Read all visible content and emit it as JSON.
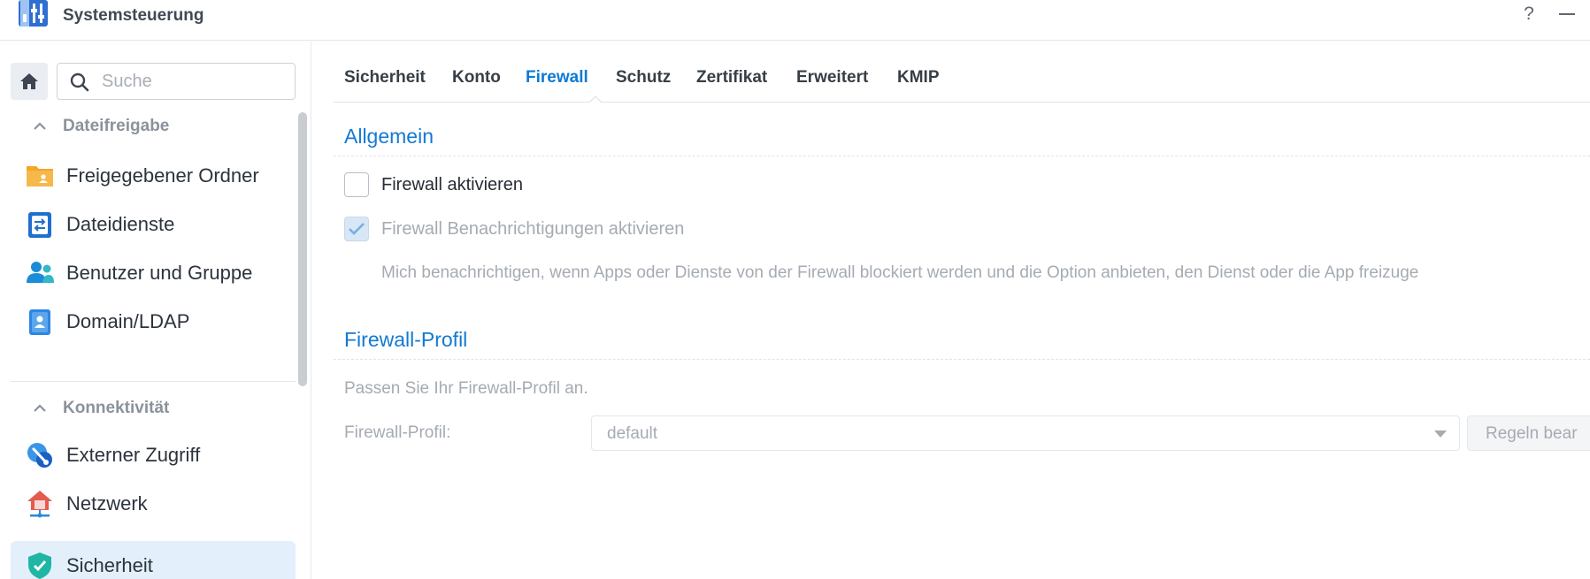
{
  "window": {
    "title": "Systemsteuerung",
    "help_label": "?",
    "app_icon": "control-panel-icon"
  },
  "sidebar": {
    "search_placeholder": "Suche",
    "sections": [
      {
        "label": "Dateifreigabe",
        "items": [
          {
            "label": "Freigegebener Ordner",
            "icon": "shared-folder-icon"
          },
          {
            "label": "Dateidienste",
            "icon": "file-services-icon"
          },
          {
            "label": "Benutzer und Gruppe",
            "icon": "user-group-icon"
          },
          {
            "label": "Domain/LDAP",
            "icon": "domain-ldap-icon"
          }
        ]
      },
      {
        "label": "Konnektivität",
        "items": [
          {
            "label": "Externer Zugriff",
            "icon": "external-access-icon"
          },
          {
            "label": "Netzwerk",
            "icon": "network-icon"
          },
          {
            "label": "Sicherheit",
            "icon": "security-shield-icon",
            "active": true
          }
        ]
      }
    ]
  },
  "tabs": [
    {
      "label": "Sicherheit"
    },
    {
      "label": "Konto"
    },
    {
      "label": "Firewall",
      "active": true
    },
    {
      "label": "Schutz"
    },
    {
      "label": "Zertifikat"
    },
    {
      "label": "Erweitert"
    },
    {
      "label": "KMIP"
    }
  ],
  "general": {
    "title": "Allgemein",
    "enable_firewall_label": "Firewall aktivieren",
    "enable_firewall_checked": false,
    "notifications_label": "Firewall Benachrichtigungen aktivieren",
    "notifications_checked": true,
    "notifications_description": "Mich benachrichtigen, wenn Apps oder Dienste von der Firewall blockiert werden und die Option anbieten, den Dienst oder die App freizuge"
  },
  "profile": {
    "title": "Firewall-Profil",
    "hint": "Passen Sie Ihr Firewall-Profil an.",
    "field_label": "Firewall-Profil:",
    "selected_value": "default",
    "edit_rules_label": "Regeln bear"
  },
  "colors": {
    "accent": "#0b7bd4",
    "active_nav_bg": "#e3f0fb",
    "disabled_text": "#a5abb2"
  }
}
